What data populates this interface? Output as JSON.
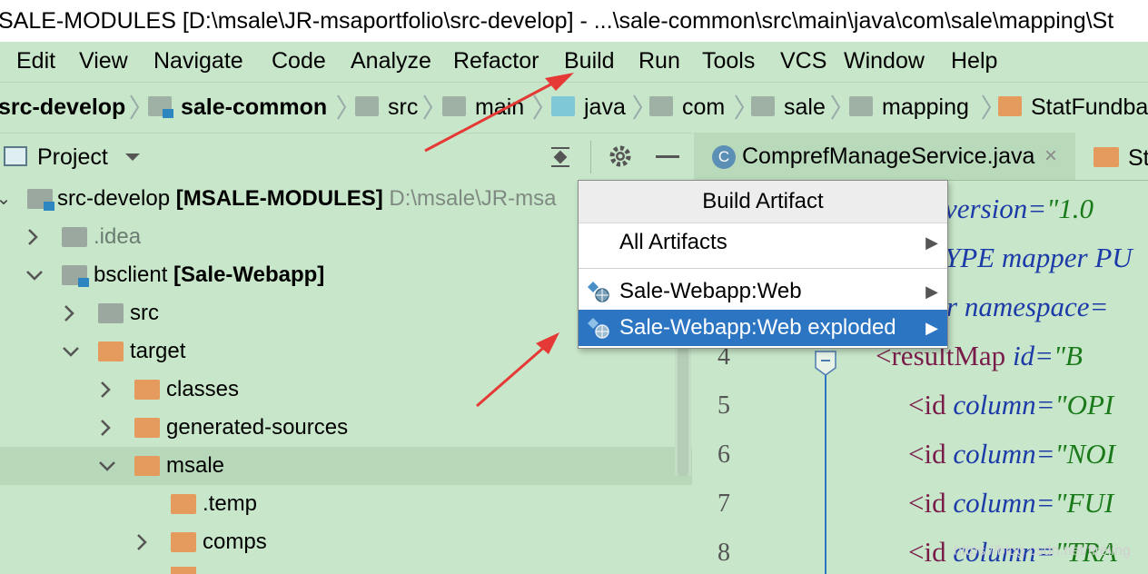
{
  "window": {
    "title": "SALE-MODULES [D:\\msale\\JR-msaportfolio\\src-develop] - ...\\sale-common\\src\\main\\java\\com\\sale\\mapping\\St"
  },
  "menu": {
    "items": [
      "Edit",
      "View",
      "Navigate",
      "Code",
      "Analyze",
      "Refactor",
      "Build",
      "Run",
      "Tools",
      "VCS",
      "Window",
      "Help"
    ]
  },
  "navbar": {
    "crumbs": [
      "src-develop",
      "sale-common",
      "src",
      "main",
      "java",
      "com",
      "sale",
      "mapping",
      "StatFundba"
    ]
  },
  "project_panel": {
    "title": "Project",
    "tree": [
      {
        "label": "src-develop",
        "suffix": "[MSALE-MODULES]",
        "path": "D:\\msale\\JR-msa"
      },
      {
        "label": ".idea"
      },
      {
        "label": "bsclient",
        "suffix": "[Sale-Webapp]"
      },
      {
        "label": "src"
      },
      {
        "label": "target"
      },
      {
        "label": "classes"
      },
      {
        "label": "generated-sources"
      },
      {
        "label": "msale"
      },
      {
        "label": ".temp"
      },
      {
        "label": "comps"
      }
    ]
  },
  "editor": {
    "tabs": [
      "ComprefManageService.java",
      "Sta"
    ],
    "line_numbers": [
      "4",
      "5",
      "6",
      "7",
      "8"
    ],
    "code_lines": [
      {
        "attr": "version=",
        "val": "\"1.0"
      },
      {
        "attr": "YPE mapper PU",
        "val": ""
      },
      {
        "attr": "r namespace=",
        "val": ""
      },
      {
        "tag": "<resultMap",
        "attr": " id=",
        "val": "\"B"
      },
      {
        "tag": "<id",
        "attr": " column=",
        "val": "\"OPI"
      },
      {
        "tag": "<id",
        "attr": " column=",
        "val": "\"NOI"
      },
      {
        "tag": "<id",
        "attr": " column=",
        "val": "\"FUI"
      },
      {
        "tag": "<id",
        "attr": " column=",
        "val": "\"TRA"
      }
    ]
  },
  "popup": {
    "title": "Build Artifact",
    "items": [
      {
        "label": "All Artifacts",
        "icon": ""
      },
      {
        "label": "Sale-Webapp:Web",
        "icon": "web-artifact-icon"
      },
      {
        "label": "Sale-Webapp:Web exploded",
        "icon": "web-artifact-icon",
        "highlighted": true
      }
    ]
  },
  "watermark": "https://blog.csdn.net/fireling"
}
